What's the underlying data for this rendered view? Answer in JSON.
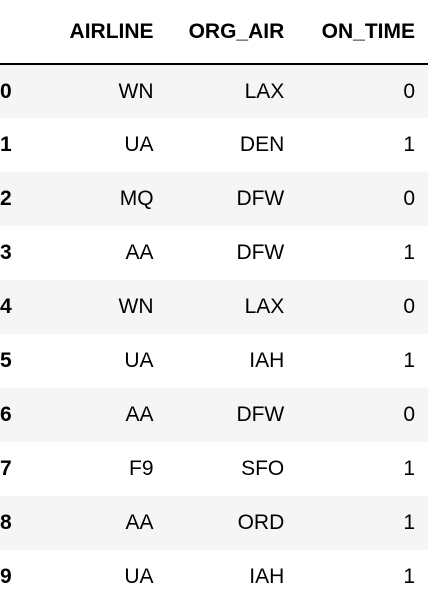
{
  "table": {
    "headers": [
      "AIRLINE",
      "ORG_AIR",
      "ON_TIME"
    ],
    "rows": [
      {
        "index": "0",
        "airline": "WN",
        "org_air": "LAX",
        "on_time": "0"
      },
      {
        "index": "1",
        "airline": "UA",
        "org_air": "DEN",
        "on_time": "1"
      },
      {
        "index": "2",
        "airline": "MQ",
        "org_air": "DFW",
        "on_time": "0"
      },
      {
        "index": "3",
        "airline": "AA",
        "org_air": "DFW",
        "on_time": "1"
      },
      {
        "index": "4",
        "airline": "WN",
        "org_air": "LAX",
        "on_time": "0"
      },
      {
        "index": "5",
        "airline": "UA",
        "org_air": "IAH",
        "on_time": "1"
      },
      {
        "index": "6",
        "airline": "AA",
        "org_air": "DFW",
        "on_time": "0"
      },
      {
        "index": "7",
        "airline": "F9",
        "org_air": "SFO",
        "on_time": "1"
      },
      {
        "index": "8",
        "airline": "AA",
        "org_air": "ORD",
        "on_time": "1"
      },
      {
        "index": "9",
        "airline": "UA",
        "org_air": "IAH",
        "on_time": "1"
      }
    ]
  },
  "colors": {
    "header_border": "#000000",
    "striped_row": "#f5f5f5",
    "plain_row": "#ffffff"
  }
}
